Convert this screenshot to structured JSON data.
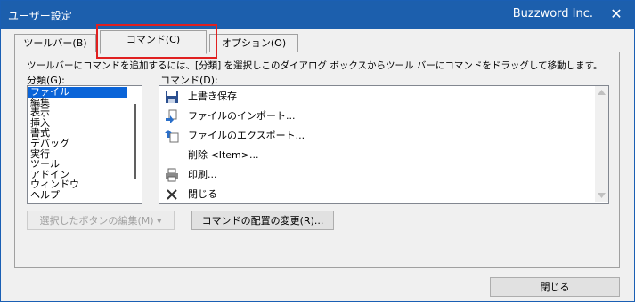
{
  "window": {
    "title": "ユーザー設定",
    "brand": "Buzzword Inc.",
    "close_glyph": "✕"
  },
  "tabs": [
    {
      "label": "ツールバー(B)"
    },
    {
      "label": "コマンド(C)"
    },
    {
      "label": "オプション(O)"
    }
  ],
  "instruction": "ツールバーにコマンドを追加するには、[分類] を選択しこのダイアログ ボックスからツール バーにコマンドをドラッグして移動します。",
  "categories": {
    "label": "分類(G):",
    "items": [
      "ファイル",
      "編集",
      "表示",
      "挿入",
      "書式",
      "デバッグ",
      "実行",
      "ツール",
      "アドイン",
      "ウィンドウ",
      "ヘルプ"
    ],
    "selected": "ファイル"
  },
  "commands": {
    "label": "コマンド(D):",
    "items": [
      {
        "label": "上書き保存",
        "icon": "save-icon"
      },
      {
        "label": "ファイルのインポート...",
        "icon": "import-file-icon"
      },
      {
        "label": "ファイルのエクスポート...",
        "icon": "export-file-icon"
      },
      {
        "label": "削除 <Item>...",
        "icon": ""
      },
      {
        "label": "印刷...",
        "icon": "print-icon"
      },
      {
        "label": "閉じる",
        "icon": "close-icon"
      }
    ]
  },
  "buttons": {
    "modify_selection": "選択したボタンの編集(M) ▾",
    "rearrange": "コマンドの配置の変更(R)...",
    "close": "閉じる"
  }
}
